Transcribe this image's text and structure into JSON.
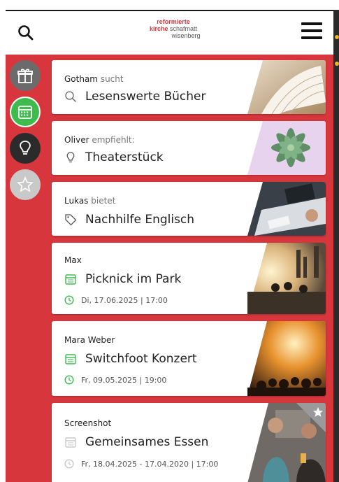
{
  "header": {
    "logo_line1": "reformierte",
    "logo_line2_red": "kirche",
    "logo_line2_gray": "schafmatt",
    "logo_line3": "wisenberg"
  },
  "sidebar": [
    {
      "icon": "gift-icon",
      "color": "#6b6b6b"
    },
    {
      "icon": "calendar-icon",
      "color": "#3dbb4d"
    },
    {
      "icon": "lightbulb-icon",
      "color": "#2b2b2b"
    },
    {
      "icon": "star-icon",
      "color": "#c9c9c9"
    }
  ],
  "cards": [
    {
      "name": "Gotham",
      "verb": "sucht",
      "title": "Lesenswerte Bücher",
      "icon": "search-icon"
    },
    {
      "name": "Oliver",
      "verb": "empfiehlt:",
      "title": "Theaterstück",
      "icon": "lightbulb-icon"
    },
    {
      "name": "Lukas",
      "verb": "bietet",
      "title": "Nachhilfe Englisch",
      "icon": "tag-icon"
    },
    {
      "name": "Max",
      "verb": "",
      "title": "Picknick im Park",
      "icon": "calendar-icon",
      "date": "Di, 17.06.2025 | 17:00"
    },
    {
      "name": "Mara Weber",
      "verb": "",
      "title": "Switchfoot Konzert",
      "icon": "calendar-icon",
      "date": "Fr, 09.05.2025 | 19:00"
    },
    {
      "name": "Screenshot",
      "verb": "",
      "title": "Gemeinsames Essen",
      "icon": "calendar-icon",
      "date": "Fr, 18.04.2025 - 17.04.2020 | 17:00"
    }
  ],
  "colors": {
    "brand_red": "#d7363c",
    "green": "#3dbb4d"
  }
}
